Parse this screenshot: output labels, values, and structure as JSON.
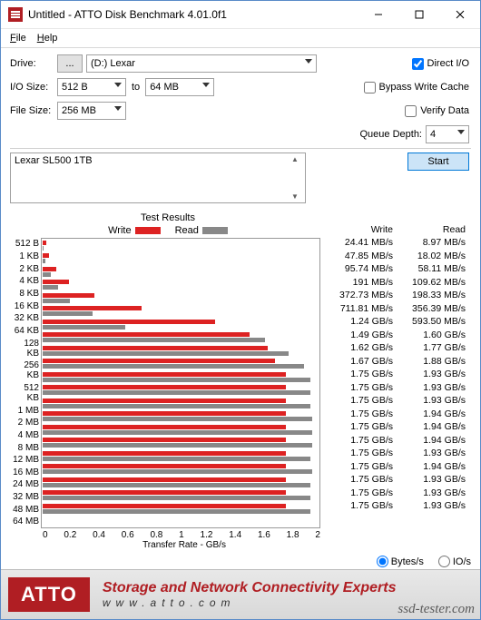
{
  "window": {
    "title": "Untitled - ATTO Disk Benchmark 4.01.0f1"
  },
  "menu": {
    "file": "File",
    "help": "Help"
  },
  "labels": {
    "drive": "Drive:",
    "iosize": "I/O Size:",
    "to": "to",
    "filesize": "File Size:",
    "directio": "Direct I/O",
    "bypass": "Bypass Write Cache",
    "verify": "Verify Data",
    "queue": "Queue Depth:",
    "start": "Start",
    "testresults": "Test Results",
    "write": "Write",
    "read": "Read",
    "xferlabel": "Transfer Rate - GB/s",
    "bytess": "Bytes/s",
    "ios": "IO/s",
    "browse": "..."
  },
  "values": {
    "drive": "(D:) Lexar",
    "iosize_from": "512 B",
    "iosize_to": "64 MB",
    "filesize": "256 MB",
    "queue": "4",
    "desc": "Lexar SL500 1TB",
    "directio": true,
    "bypass": false,
    "verify": false,
    "bytes_selected": true
  },
  "footer": {
    "logo": "ATTO",
    "line1": "Storage and Network Connectivity Experts",
    "line2": "www.atto.com"
  },
  "watermark": "ssd-tester.com",
  "xticks": [
    "0",
    "0.2",
    "0.4",
    "0.6",
    "0.8",
    "1",
    "1.2",
    "1.4",
    "1.6",
    "1.8",
    "2"
  ],
  "chart_data": {
    "type": "bar",
    "title": "Test Results",
    "xlabel": "Transfer Rate - GB/s",
    "xlim": [
      0,
      2
    ],
    "categories": [
      "512 B",
      "1 KB",
      "2 KB",
      "4 KB",
      "8 KB",
      "16 KB",
      "32 KB",
      "64 KB",
      "128 KB",
      "256 KB",
      "512 KB",
      "1 MB",
      "2 MB",
      "4 MB",
      "8 MB",
      "12 MB",
      "16 MB",
      "24 MB",
      "32 MB",
      "48 MB",
      "64 MB"
    ],
    "series": [
      {
        "name": "Write",
        "color": "#d22",
        "values_text": [
          "24.41 MB/s",
          "47.85 MB/s",
          "95.74 MB/s",
          "191 MB/s",
          "372.73 MB/s",
          "711.81 MB/s",
          "1.24 GB/s",
          "1.49 GB/s",
          "1.62 GB/s",
          "1.67 GB/s",
          "1.75 GB/s",
          "1.75 GB/s",
          "1.75 GB/s",
          "1.75 GB/s",
          "1.75 GB/s",
          "1.75 GB/s",
          "1.75 GB/s",
          "1.75 GB/s",
          "1.75 GB/s",
          "1.75 GB/s",
          "1.75 GB/s"
        ],
        "values_gbps": [
          0.02441,
          0.04785,
          0.09574,
          0.191,
          0.37273,
          0.71181,
          1.24,
          1.49,
          1.62,
          1.67,
          1.75,
          1.75,
          1.75,
          1.75,
          1.75,
          1.75,
          1.75,
          1.75,
          1.75,
          1.75,
          1.75
        ]
      },
      {
        "name": "Read",
        "color": "#888",
        "values_text": [
          "8.97 MB/s",
          "18.02 MB/s",
          "58.11 MB/s",
          "109.62 MB/s",
          "198.33 MB/s",
          "356.39 MB/s",
          "593.50 MB/s",
          "1.60 GB/s",
          "1.77 GB/s",
          "1.88 GB/s",
          "1.93 GB/s",
          "1.93 GB/s",
          "1.93 GB/s",
          "1.94 GB/s",
          "1.94 GB/s",
          "1.94 GB/s",
          "1.93 GB/s",
          "1.94 GB/s",
          "1.93 GB/s",
          "1.93 GB/s",
          "1.93 GB/s"
        ],
        "values_gbps": [
          0.00897,
          0.01802,
          0.05811,
          0.10962,
          0.19833,
          0.35639,
          0.5935,
          1.6,
          1.77,
          1.88,
          1.93,
          1.93,
          1.93,
          1.94,
          1.94,
          1.94,
          1.93,
          1.94,
          1.93,
          1.93,
          1.93
        ]
      }
    ]
  }
}
